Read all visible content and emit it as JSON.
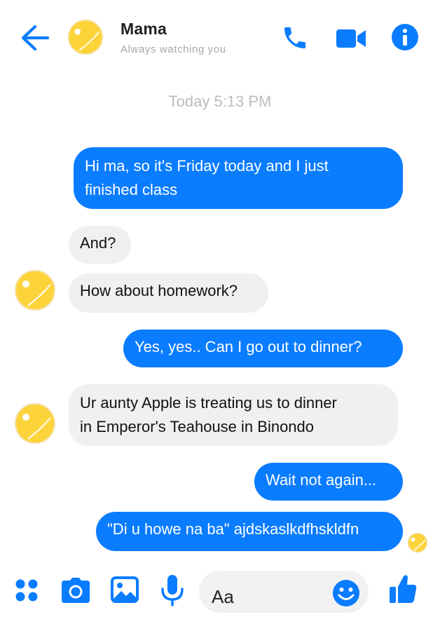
{
  "header": {
    "contact_name": "Mama",
    "contact_status": "Always watching you",
    "icons": [
      "back-arrow-icon",
      "avatar",
      "phone-icon",
      "video-camera-icon",
      "info-icon"
    ]
  },
  "conversation": {
    "timestamp": "Today 5:13 PM",
    "messages": [
      {
        "sender": "me",
        "line1": "Hi ma, so it's Friday today and I just",
        "line2": "finished class"
      },
      {
        "sender": "mama",
        "text": "And?"
      },
      {
        "sender": "mama",
        "text": "How about homework?"
      },
      {
        "sender": "me",
        "text": "Yes, yes.. Can I go out to dinner?"
      },
      {
        "sender": "mama",
        "line1": "Ur aunty Apple is treating us to dinner",
        "line2": "in Emperor's Teahouse in Binondo"
      },
      {
        "sender": "me",
        "text": "Wait not again..."
      },
      {
        "sender": "me",
        "text": "\"Di u howe na ba\" ajdskaslkdfhskldfn"
      }
    ]
  },
  "composer": {
    "placeholder": "Aa",
    "icons": [
      "apps-icon",
      "camera-icon",
      "image-icon",
      "microphone-icon",
      "emoji-icon",
      "thumbs-up-icon"
    ]
  },
  "colors": {
    "accent": "#0a7cff",
    "incoming_bubble": "#f0f0f0",
    "avatar_yellow": "#fdd33a"
  }
}
